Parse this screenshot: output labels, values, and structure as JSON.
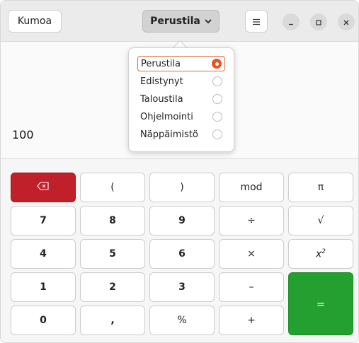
{
  "header": {
    "undo_label": "Kumoa",
    "mode_label": "Perustila"
  },
  "display": {
    "value": "100"
  },
  "mode_menu": {
    "items": [
      {
        "label": "Perustila",
        "selected": true
      },
      {
        "label": "Edistynyt",
        "selected": false
      },
      {
        "label": "Taloustila",
        "selected": false
      },
      {
        "label": "Ohjelmointi",
        "selected": false
      },
      {
        "label": "Näppäimistö",
        "selected": false
      }
    ]
  },
  "keys": {
    "backspace": "⌫",
    "open_paren": "(",
    "close_paren": ")",
    "mod": "mod",
    "pi": "π",
    "k7": "7",
    "k8": "8",
    "k9": "9",
    "divide": "÷",
    "sqrt": "√",
    "k4": "4",
    "k5": "5",
    "k6": "6",
    "multiply": "×",
    "square_base": "x",
    "square_exp": "2",
    "k1": "1",
    "k2": "2",
    "k3": "3",
    "minus": "–",
    "equals": "=",
    "k0": "0",
    "decimal": ",",
    "percent": "%",
    "plus": "+"
  },
  "colors": {
    "accent": "#e95420",
    "backspace_bg": "#c0202a",
    "equals_bg": "#23a02f"
  },
  "icons": {
    "menu": "hamburger-icon",
    "minimize": "minimize-icon",
    "maximize": "maximize-icon",
    "close": "close-icon",
    "dropdown": "chevron-down-icon"
  }
}
